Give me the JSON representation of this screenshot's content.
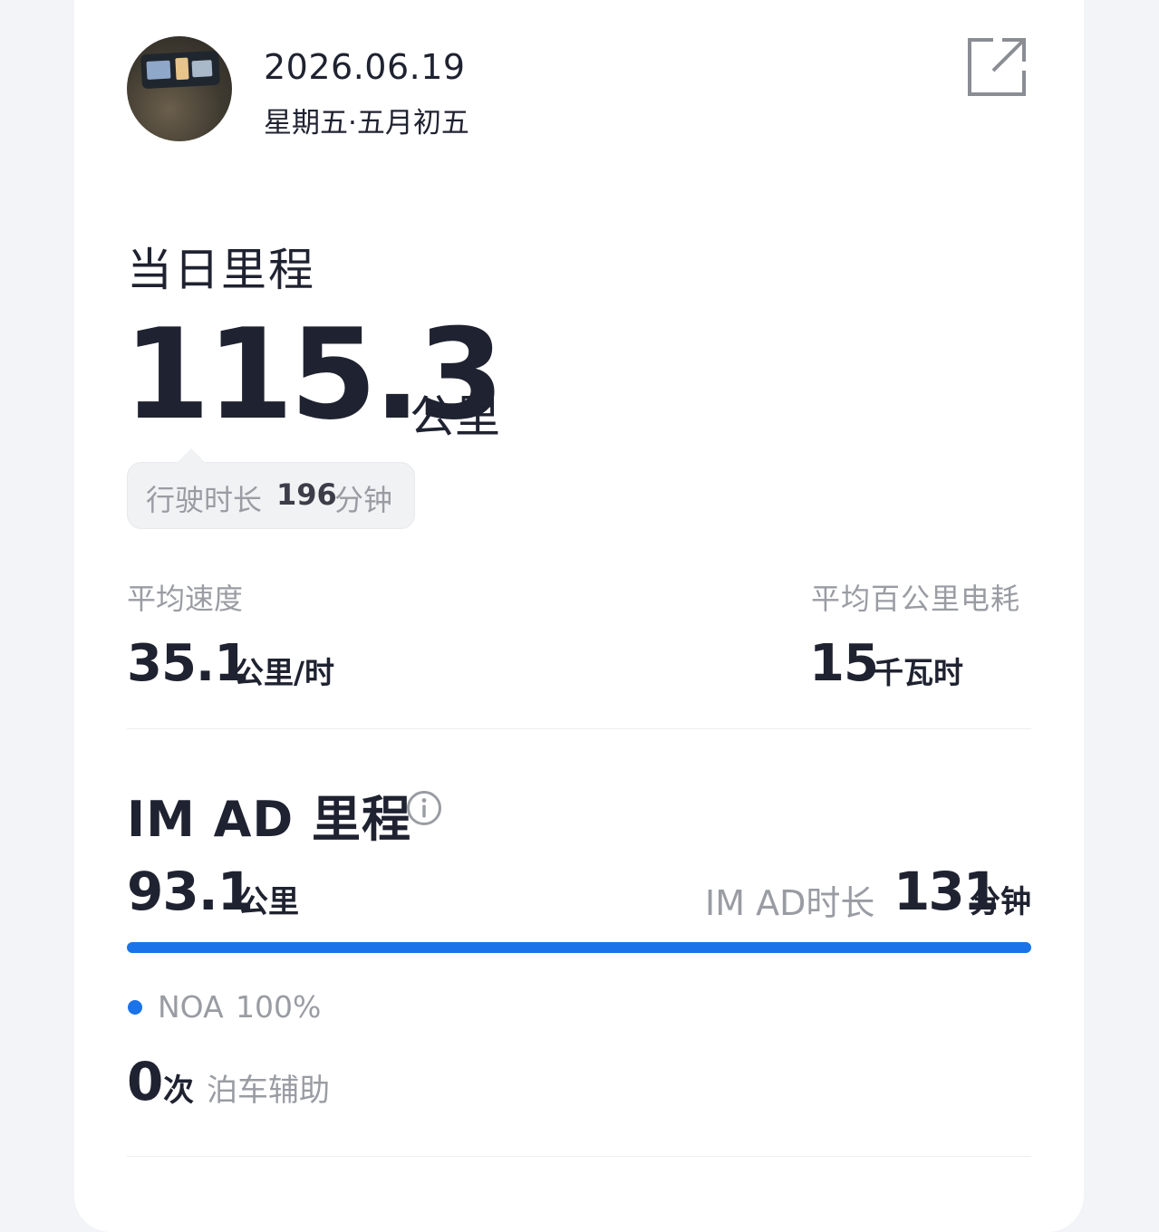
{
  "header": {
    "date": "2026.06.19",
    "weekday": "星期五·五月初五",
    "avatar_icon": "dashboard-photo",
    "share_icon": "share-external-icon"
  },
  "daily": {
    "title": "当日里程",
    "distance": "115.3",
    "distance_unit": "公里",
    "duration_label": "行驶时长",
    "duration_value": "196",
    "duration_unit": "分钟"
  },
  "stats": {
    "avg_speed_label": "平均速度",
    "avg_speed_value": "35.1",
    "avg_speed_unit": "公里/时",
    "energy_label": "平均百公里电耗",
    "energy_value": "15",
    "energy_unit": "千瓦时"
  },
  "imad": {
    "title": "IM AD 里程",
    "info_icon": "info-icon",
    "distance": "93.1",
    "distance_unit": "公里",
    "duration_label": "IM AD时长",
    "duration_value": "131",
    "duration_unit": "分钟",
    "progress_fraction": 1.0,
    "noa_label": "NOA",
    "noa_percent": "100%",
    "parking_count": "0",
    "parking_unit": "次",
    "parking_label": "泊车辅助"
  },
  "colors": {
    "accent": "#1a73e8",
    "text_primary": "#1f2230",
    "text_secondary": "#9a9ca3",
    "card": "#ffffff"
  }
}
